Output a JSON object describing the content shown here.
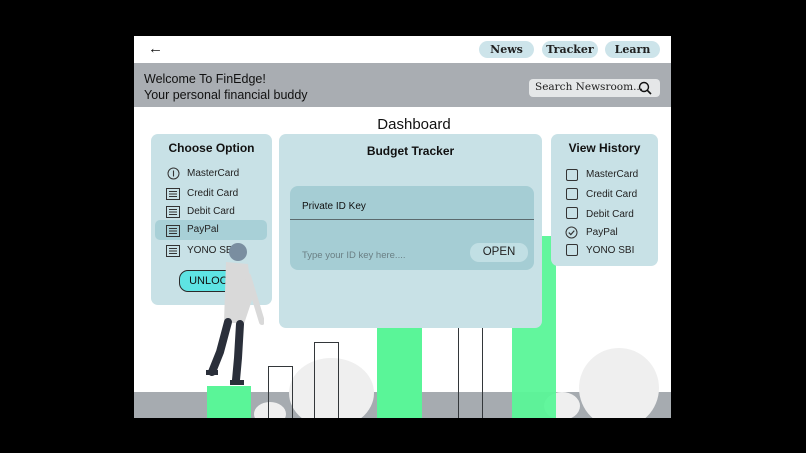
{
  "nav": {
    "back_icon": "arrow-left-icon",
    "news_label": "News",
    "tracker_label": "Tracker",
    "learn_label": "Learn"
  },
  "banner": {
    "welcome_line1": "Welcome To FinEdge!",
    "welcome_line2": "Your personal financial buddy",
    "search_placeholder": "Search Newsroom...",
    "search_icon": "search-icon"
  },
  "page_title": "Dashboard",
  "choose_option": {
    "title": "Choose Option",
    "items": [
      {
        "label": "MasterCard",
        "icon": "info-icon"
      },
      {
        "label": "Credit Card",
        "icon": "card-icon"
      },
      {
        "label": "Debit Card",
        "icon": "card-icon"
      },
      {
        "label": "PayPal",
        "icon": "card-icon",
        "selected": true
      },
      {
        "label": "YONO SBI",
        "icon": "card-icon"
      }
    ],
    "unlock_label": "UNLOCK"
  },
  "budget_tracker": {
    "title": "Budget Tracker",
    "key_label": "Private ID Key",
    "key_placeholder": "Type your ID key here....",
    "open_label": "OPEN"
  },
  "view_history": {
    "title": "View History",
    "items": [
      {
        "label": "MasterCard",
        "checked": false
      },
      {
        "label": "Credit Card",
        "checked": false
      },
      {
        "label": "Debit Card",
        "checked": false
      },
      {
        "label": "PayPal",
        "checked": true
      },
      {
        "label": "YONO SBI",
        "checked": false
      }
    ]
  },
  "colors": {
    "accent_green": "#5af598",
    "panel": "#c8e1e6",
    "unlock": "#5ee3e3",
    "banner": "#a9adb2"
  }
}
